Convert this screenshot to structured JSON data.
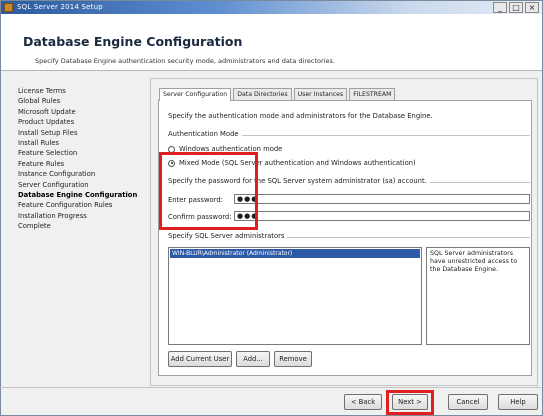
{
  "window": {
    "title": "SQL Server 2014 Setup",
    "controls": [
      "_",
      "□",
      "×"
    ]
  },
  "header": {
    "title": "Database Engine Configuration",
    "subtitle": "Specify Database Engine authentication security mode, administrators and data directories."
  },
  "nav": {
    "items": [
      {
        "label": "License Terms",
        "active": false
      },
      {
        "label": "Global Rules",
        "active": false
      },
      {
        "label": "Microsoft Update",
        "active": false
      },
      {
        "label": "Product Updates",
        "active": false
      },
      {
        "label": "Install Setup Files",
        "active": false
      },
      {
        "label": "Install Rules",
        "active": false
      },
      {
        "label": "Feature Selection",
        "active": false
      },
      {
        "label": "Feature Rules",
        "active": false
      },
      {
        "label": "Instance Configuration",
        "active": false
      },
      {
        "label": "Server Configuration",
        "active": false
      },
      {
        "label": "Database Engine Configuration",
        "active": true
      },
      {
        "label": "Feature Configuration Rules",
        "active": false
      },
      {
        "label": "Installation Progress",
        "active": false
      },
      {
        "label": "Complete",
        "active": false
      }
    ]
  },
  "tabs": [
    {
      "label": "Server Configuration",
      "active": true
    },
    {
      "label": "Data Directories",
      "active": false
    },
    {
      "label": "User Instances",
      "active": false
    },
    {
      "label": "FILESTREAM",
      "active": false
    }
  ],
  "server_config": {
    "description": "Specify the authentication mode and administrators for the Database Engine.",
    "auth_group_label": "Authentication Mode",
    "windows_auth_label": "Windows authentication mode",
    "mixed_mode_label": "Mixed Mode (SQL Server authentication and Windows authentication)",
    "selected_mode": "mixed",
    "password_group_label": "Specify the password for the SQL Server system administrator (sa) account.",
    "enter_password_label": "Enter password:",
    "enter_password_value": "●●●",
    "confirm_password_label": "Confirm password:",
    "confirm_password_value": "●●●",
    "admins_group_label": "Specify SQL Server administrators",
    "admins": [
      "WIN-BLUR\\Administrator (Administrator)"
    ],
    "admin_info": "SQL Server administrators have unrestricted access to the Database Engine.",
    "add_current_user_label": "Add Current User",
    "add_label": "Add...",
    "remove_label": "Remove"
  },
  "footer": {
    "back_label": "< Back",
    "next_label": "Next >",
    "cancel_label": "Cancel",
    "help_label": "Help"
  },
  "colors": {
    "highlight": "#e02020",
    "selection": "#2d5aa8",
    "title_bar": "#2b5a9e"
  }
}
